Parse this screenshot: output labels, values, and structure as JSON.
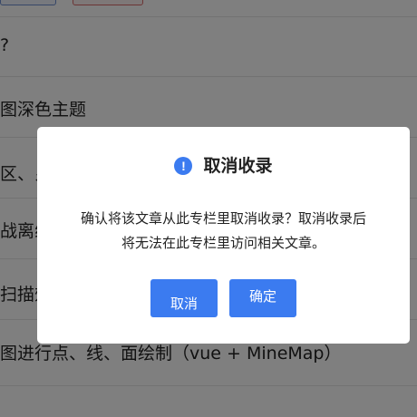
{
  "background": {
    "rows": [
      {
        "text": "?"
      },
      {
        "text": "图深色主题"
      },
      {
        "text": "区、乡"
      },
      {
        "text": "战离线"
      },
      {
        "text": "扫描效"
      },
      {
        "text": "图进行点、线、面绘制（vue + MineMap）"
      }
    ]
  },
  "dialog": {
    "icon": "exclamation-circle-icon",
    "icon_glyph": "!",
    "title": "取消收录",
    "message_line1": "确认将该文章从此专栏里取消收录？取消收录后",
    "message_line2": "将无法在此专栏里访问相关文章。",
    "cancel_label": "取消",
    "confirm_label": "确定"
  },
  "colors": {
    "accent": "#3b7bf0",
    "overlay": "rgba(0,0,0,0.5)"
  }
}
